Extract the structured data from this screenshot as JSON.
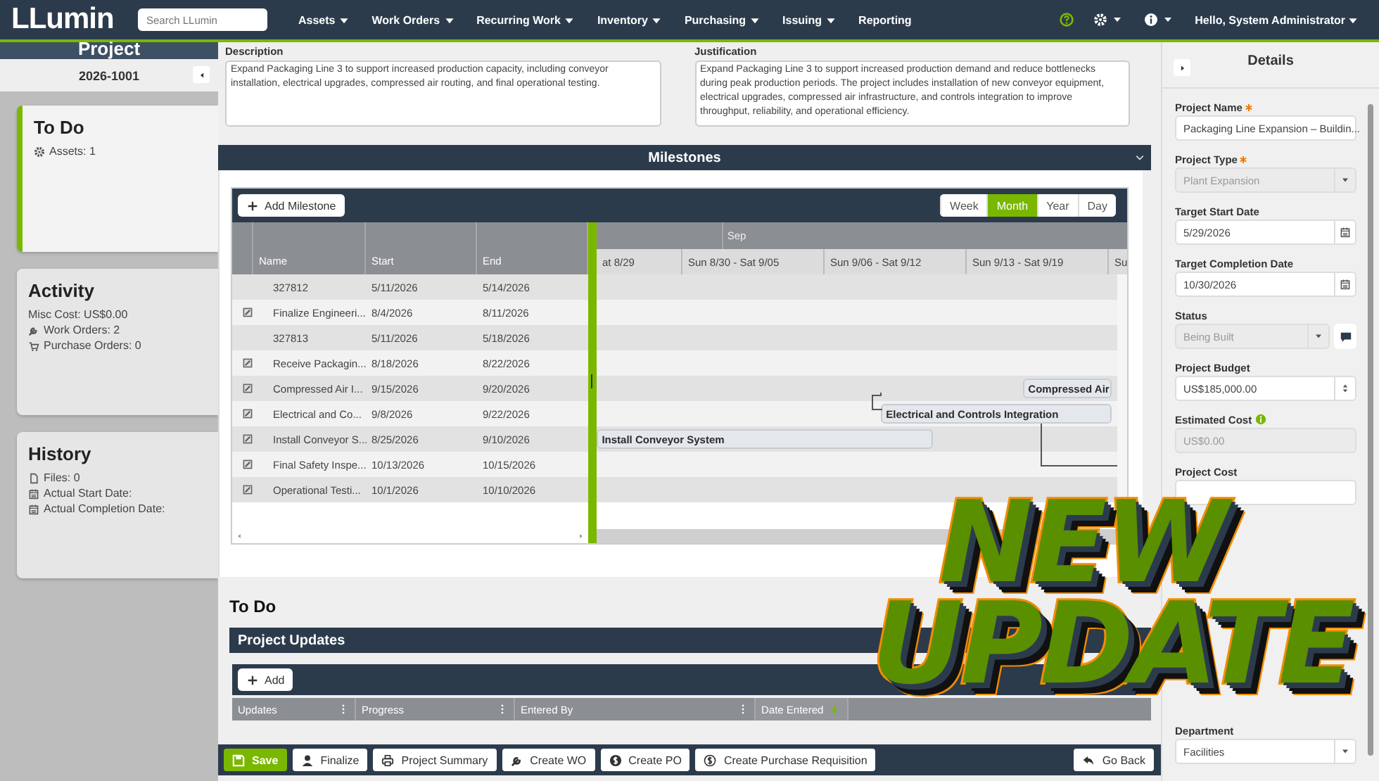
{
  "nav": {
    "logo": "LLumin",
    "search": {
      "placeholder": "Search LLumin"
    },
    "menu": [
      {
        "label": "Assets",
        "dropdown": true
      },
      {
        "label": "Work Orders",
        "dropdown": true
      },
      {
        "label": "Recurring Work",
        "dropdown": true
      },
      {
        "label": "Inventory",
        "dropdown": true
      },
      {
        "label": "Purchasing",
        "dropdown": true
      },
      {
        "label": "Issuing",
        "dropdown": true
      },
      {
        "label": "Reporting",
        "dropdown": false
      }
    ],
    "user": "Hello, System Administrator"
  },
  "left": {
    "title": "Project",
    "record": "2026-1001",
    "cards": [
      {
        "title": "To Do",
        "selected": true,
        "items": [
          {
            "kind": "assets",
            "text": "Assets: 1"
          }
        ]
      },
      {
        "title": "Activity",
        "selected": false,
        "items": [
          {
            "kind": "cost",
            "text": "Misc Cost: US$0.00"
          },
          {
            "kind": "work-orders",
            "text": "Work Orders: 2"
          },
          {
            "kind": "purchase-orders",
            "text": "Purchase Orders: 0"
          }
        ]
      },
      {
        "title": "History",
        "selected": false,
        "items": [
          {
            "kind": "files",
            "text": "Files: 0"
          },
          {
            "kind": "date",
            "text": "Actual Start Date:"
          },
          {
            "kind": "date",
            "text": "Actual Completion Date:"
          }
        ]
      }
    ]
  },
  "description": {
    "label": "Description",
    "value": "Expand Packaging Line 3 to support increased production capacity, including conveyor installation, electrical upgrades, compressed air routing, and final operational testing."
  },
  "justification": {
    "label": "Justification",
    "value": "Expand Packaging Line 3 to support increased production demand and reduce bottlenecks during peak production periods. The project includes installation of new conveyor equipment, electrical upgrades, compressed air infrastructure, and controls integration to improve throughput, reliability, and operational efficiency."
  },
  "milestones": {
    "title": "Milestones",
    "add_button": "Add Milestone",
    "views": [
      {
        "label": "Week",
        "selected": false
      },
      {
        "label": "Month",
        "selected": true
      },
      {
        "label": "Year",
        "selected": false
      },
      {
        "label": "Day",
        "selected": false
      }
    ],
    "columns": [
      "Name",
      "Start",
      "End"
    ],
    "rows": [
      {
        "editable": false,
        "name": "327812",
        "start": "5/11/2026",
        "end": "5/14/2026"
      },
      {
        "editable": true,
        "name": "Finalize Engineeri...",
        "start": "8/4/2026",
        "end": "8/11/2026"
      },
      {
        "editable": false,
        "name": "327813",
        "start": "5/11/2026",
        "end": "5/18/2026"
      },
      {
        "editable": true,
        "name": "Receive Packagin...",
        "start": "8/18/2026",
        "end": "8/22/2026"
      },
      {
        "editable": true,
        "name": "Compressed Air I...",
        "start": "9/15/2026",
        "end": "9/20/2026",
        "bar_label": "Compressed Air"
      },
      {
        "editable": true,
        "name": "Electrical and Co...",
        "start": "9/8/2026",
        "end": "9/22/2026",
        "bar_label": "Electrical and Controls Integration"
      },
      {
        "editable": true,
        "name": "Install Conveyor S...",
        "start": "8/25/2026",
        "end": "9/10/2026",
        "bar_label": "Install Conveyor System"
      },
      {
        "editable": true,
        "name": "Final Safety Inspe...",
        "start": "10/13/2026",
        "end": "10/15/2026"
      },
      {
        "editable": true,
        "name": "Operational Testi...",
        "start": "10/1/2026",
        "end": "10/10/2026"
      }
    ],
    "month": "Sep",
    "weeks": [
      "at 8/29",
      "Sun 8/30 - Sat 9/05",
      "Sun 9/06 - Sat 9/12",
      "Sun 9/13 - Sat 9/19",
      "Su"
    ]
  },
  "todo_heading": "To Do",
  "updates": {
    "title": "Project Updates",
    "add_button": "Add",
    "columns": [
      {
        "label": "Updates",
        "menu": true,
        "sorted": false
      },
      {
        "label": "Progress",
        "menu": true,
        "sorted": false
      },
      {
        "label": "Entered By",
        "menu": true,
        "sorted": false
      },
      {
        "label": "Date Entered",
        "menu": false,
        "sorted": true
      }
    ]
  },
  "actions": [
    {
      "label": "Save",
      "kind": "save"
    },
    {
      "label": "Finalize",
      "kind": "finalize"
    },
    {
      "label": "Project Summary",
      "kind": "summary"
    },
    {
      "label": "Create WO",
      "kind": "work-order"
    },
    {
      "label": "Create PO",
      "kind": "purchase-order"
    },
    {
      "label": "Create Purchase Requisition",
      "kind": "requisition"
    },
    {
      "label": "Go Back",
      "kind": "back"
    }
  ],
  "details": {
    "title": "Details",
    "fields": [
      {
        "label": "Project Name",
        "required": true,
        "kind": "text",
        "value": "Packaging Line Expansion – Buildin...",
        "disabled": false
      },
      {
        "label": "Project Type",
        "required": true,
        "kind": "select",
        "value": "Plant Expansion",
        "disabled": true
      },
      {
        "label": "Target Start Date",
        "required": false,
        "kind": "date",
        "value": "5/29/2026",
        "disabled": false
      },
      {
        "label": "Target Completion Date",
        "required": false,
        "kind": "date",
        "value": "10/30/2026",
        "disabled": false
      },
      {
        "label": "Status",
        "required": false,
        "kind": "select",
        "value": "Being Built",
        "disabled": true,
        "comment": true
      },
      {
        "label": "Project Budget",
        "required": false,
        "kind": "number",
        "value": "US$185,000.00",
        "disabled": false
      },
      {
        "label": "Estimated Cost",
        "required": false,
        "kind": "text",
        "value": "US$0.00",
        "disabled": true,
        "info": true
      },
      {
        "label": "Project Cost",
        "required": false,
        "kind": "text",
        "disabled": false
      },
      {
        "label": "Department",
        "required": false,
        "kind": "select",
        "value": "Facilities",
        "disabled": false
      }
    ]
  },
  "overlay": {
    "lines": [
      "NEW",
      "UPDATE"
    ]
  }
}
